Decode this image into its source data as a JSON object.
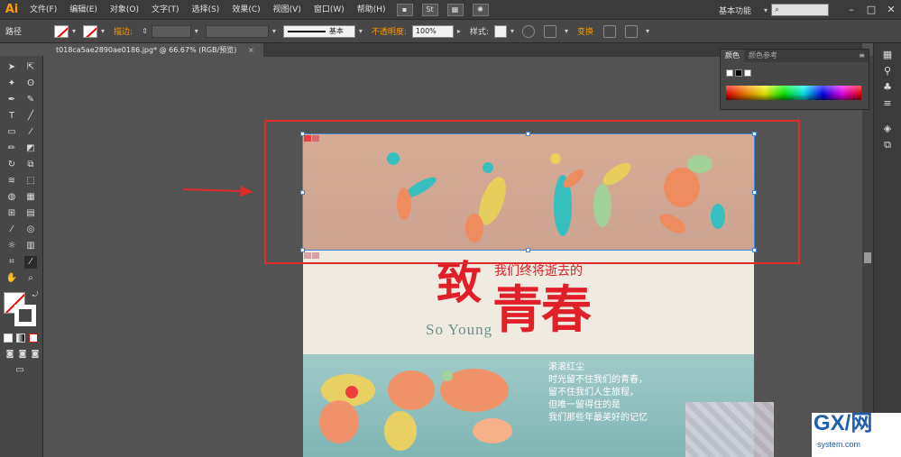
{
  "app": {
    "logo": "Ai"
  },
  "menubar": {
    "items": [
      "文件(F)",
      "编辑(E)",
      "对象(O)",
      "文字(T)",
      "选择(S)",
      "效果(C)",
      "视图(V)",
      "窗口(W)",
      "帮助(H)"
    ],
    "st_label": "St",
    "workspace": "基本功能",
    "window_buttons": [
      "–",
      "□",
      "✕"
    ]
  },
  "controlbar": {
    "object_type": "路径",
    "stroke_label": "描边:",
    "stroke_profile": "基本",
    "opacity_label": "不透明度:",
    "opacity_value": "100%",
    "style_label": "样式:",
    "transform_label": "变换"
  },
  "document": {
    "tab_title": "t018ca5ae2890ae0186.jpg* @ 66.67% (RGB/预览)",
    "tab_close": "×"
  },
  "color_panel": {
    "tabs": [
      "颜色",
      "颜色参考"
    ],
    "menu_icon": "≡"
  },
  "artwork": {
    "small_title": "我们终将逝去的",
    "big_char": "致",
    "big_title": "青春",
    "subtitle": "So Young",
    "poem": [
      "滚滚红尘",
      "时光留不住我们的青春，",
      "留不住我们人生旅程，",
      "但唯一留得住的是",
      "我们那些年最美好的记忆"
    ]
  },
  "watermark": {
    "brand": "GX/网",
    "site": "system.com"
  },
  "colors": {
    "accent_orange": "#ff9a00",
    "selection_blue": "#3f86d8",
    "annotation_red": "#e02b2b",
    "title_red": "#e01f29"
  }
}
